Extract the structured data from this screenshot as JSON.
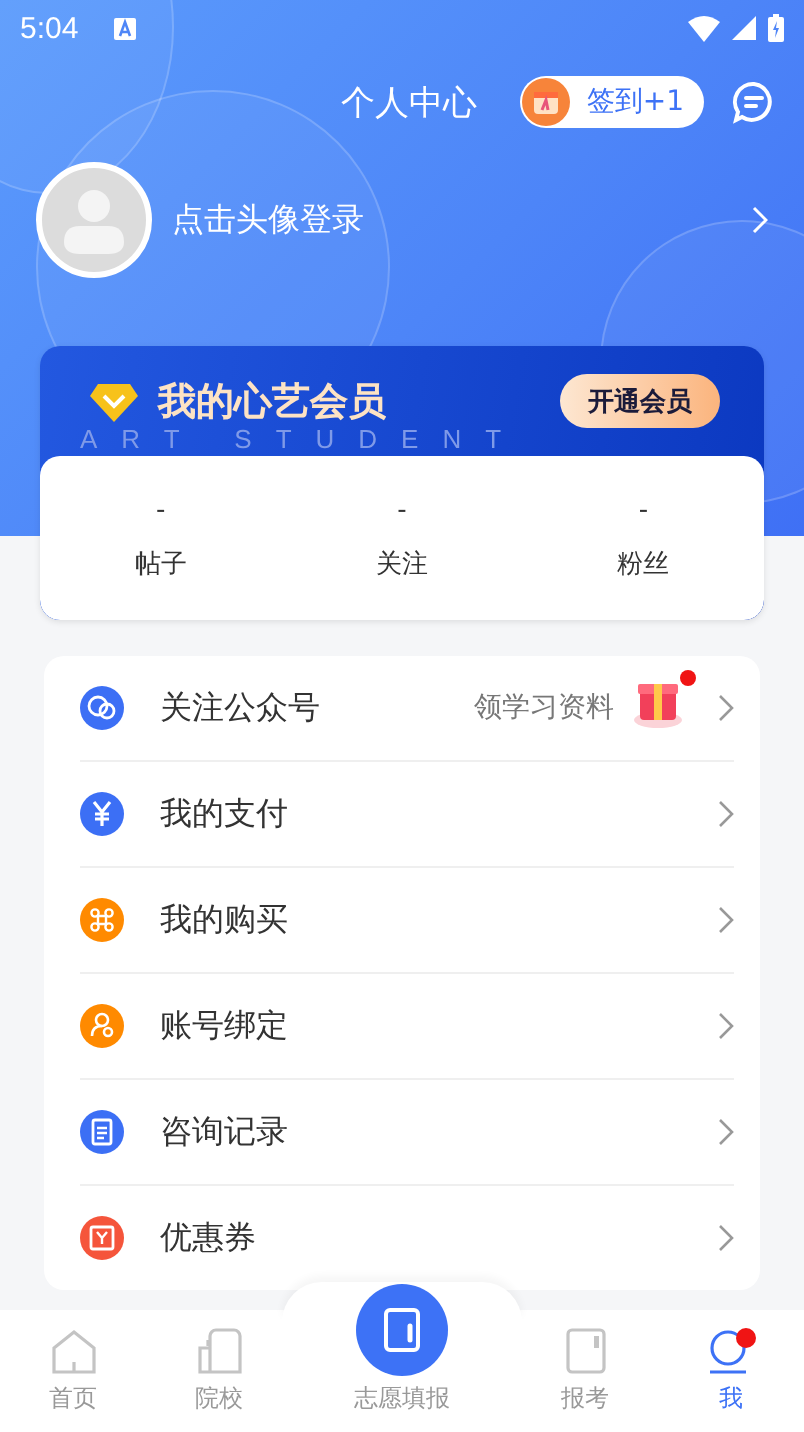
{
  "status_bar": {
    "time": "5:04"
  },
  "header": {
    "title": "个人中心",
    "checkin": "签到+1",
    "login_prompt": "点击头像登录"
  },
  "membership": {
    "title": "我的心艺会员",
    "button": "开通会员",
    "watermark": "ART STUDENT"
  },
  "stats": [
    {
      "value": "-",
      "label": "帖子"
    },
    {
      "value": "-",
      "label": "关注"
    },
    {
      "value": "-",
      "label": "粉丝"
    }
  ],
  "menu": [
    {
      "kind": "wechat",
      "color": "#3c6ff5",
      "label": "关注公众号",
      "note": "领学习资料",
      "badge": true
    },
    {
      "kind": "yuan",
      "color": "#3c6ff5",
      "label": "我的支付",
      "badge": false
    },
    {
      "kind": "grid",
      "color": "#ff8a00",
      "label": "我的购买",
      "badge": false
    },
    {
      "kind": "user",
      "color": "#ff8a00",
      "label": "账号绑定",
      "badge": false
    },
    {
      "kind": "doc",
      "color": "#3c6ff5",
      "label": "咨询记录",
      "badge": false
    },
    {
      "kind": "ticket",
      "color": "#f5553b",
      "label": "优惠券",
      "badge": false
    }
  ],
  "tab_bar": [
    {
      "kind": "home",
      "label": "首页",
      "selected": false,
      "badge": false
    },
    {
      "kind": "school",
      "label": "院校",
      "selected": false,
      "badge": false
    },
    {
      "kind": "center",
      "label": "志愿填报",
      "selected": false,
      "badge": false
    },
    {
      "kind": "exam",
      "label": "报考",
      "selected": false,
      "badge": false
    },
    {
      "kind": "me",
      "label": "我",
      "selected": true,
      "badge": true
    }
  ]
}
